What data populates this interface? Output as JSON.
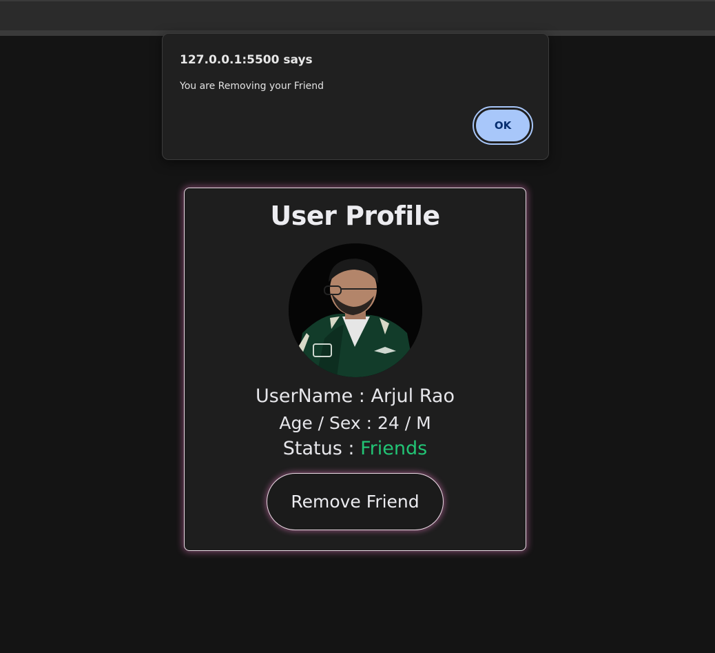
{
  "dialog": {
    "title": "127.0.0.1:5500 says",
    "message": "You are Removing your Friend",
    "ok_label": "OK"
  },
  "profile": {
    "title": "User Profile",
    "username_label": "UserName : ",
    "username": "Arjul Rao",
    "age_sex_label": "Age / Sex : ",
    "age_sex": "24 / M",
    "status_label": "Status : ",
    "status": "Friends",
    "remove_button_label": "Remove Friend"
  },
  "colors": {
    "background": "#141414",
    "card_background": "#1e1e1e",
    "card_glow": "#e678be",
    "status_accent": "#22c475",
    "dialog_button": "#a8c7fa"
  },
  "icons": {
    "avatar": "user-photo"
  }
}
